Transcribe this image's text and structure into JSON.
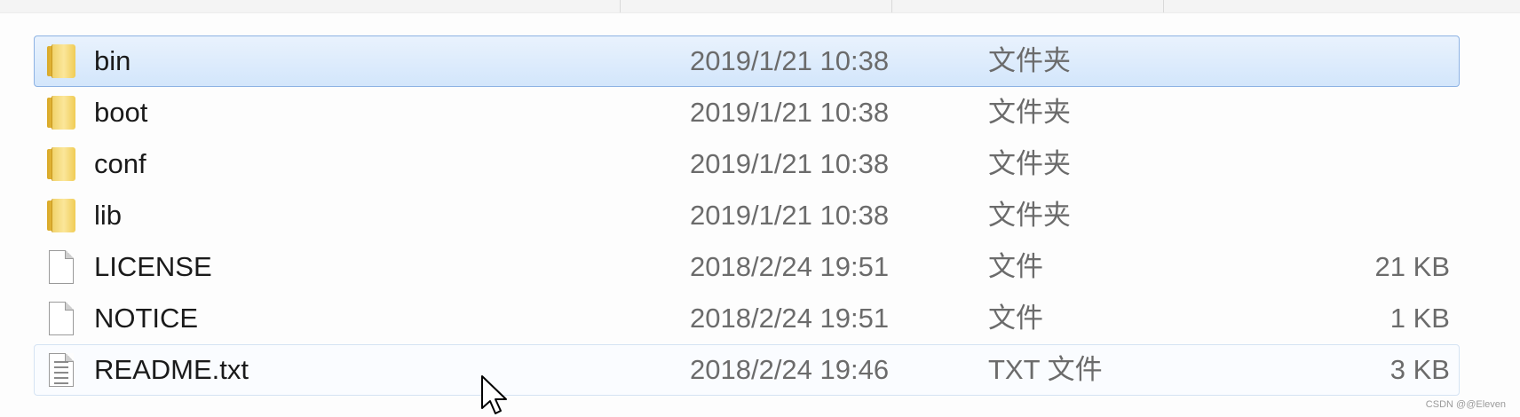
{
  "files": [
    {
      "name": "bin",
      "date": "2019/1/21 10:38",
      "type": "文件夹",
      "size": "",
      "icon": "folder-icon",
      "state": "selected"
    },
    {
      "name": "boot",
      "date": "2019/1/21 10:38",
      "type": "文件夹",
      "size": "",
      "icon": "folder-icon",
      "state": ""
    },
    {
      "name": "conf",
      "date": "2019/1/21 10:38",
      "type": "文件夹",
      "size": "",
      "icon": "folder-icon",
      "state": ""
    },
    {
      "name": "lib",
      "date": "2019/1/21 10:38",
      "type": "文件夹",
      "size": "",
      "icon": "folder-icon",
      "state": ""
    },
    {
      "name": "LICENSE",
      "date": "2018/2/24 19:51",
      "type": "文件",
      "size": "21 KB",
      "icon": "file-icon",
      "state": ""
    },
    {
      "name": "NOTICE",
      "date": "2018/2/24 19:51",
      "type": "文件",
      "size": "1 KB",
      "icon": "file-icon",
      "state": ""
    },
    {
      "name": "README.txt",
      "date": "2018/2/24 19:46",
      "type": "TXT 文件",
      "size": "3 KB",
      "icon": "text-file-icon",
      "state": "hovered"
    }
  ],
  "watermark": "CSDN @@Eleven",
  "colors": {
    "selection_border": "#8db2e3",
    "selection_fill": "#d3e6fb",
    "folder_yellow": "#f4cf5c"
  }
}
